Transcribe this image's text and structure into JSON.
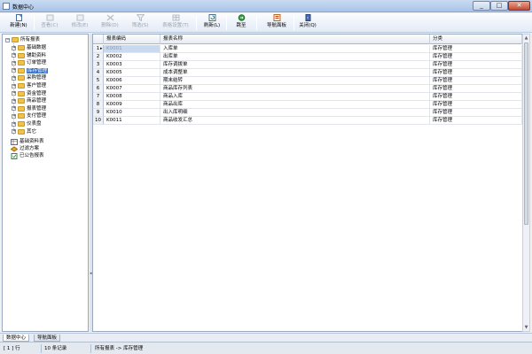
{
  "window": {
    "title": "数据中心"
  },
  "toolbar": {
    "buttons": [
      {
        "label": "新建(N)",
        "icon": "new-file-icon",
        "enabled": true
      },
      {
        "label": "查看(C)",
        "icon": "view-icon",
        "enabled": false
      },
      {
        "label": "修改(E)",
        "icon": "edit-icon",
        "enabled": false
      },
      {
        "label": "删除(D)",
        "icon": "delete-icon",
        "enabled": false
      },
      {
        "label": "筛选(S)",
        "icon": "filter-icon",
        "enabled": false
      },
      {
        "label": "表格设置(T)",
        "icon": "table-settings-icon",
        "enabled": false
      },
      {
        "label": "刷新(L)",
        "icon": "refresh-icon",
        "enabled": true
      },
      {
        "label": "跳至",
        "icon": "goto-icon",
        "enabled": true
      },
      {
        "label": "导航面板",
        "icon": "nav-panel-icon",
        "enabled": true
      },
      {
        "label": "关闭(Q)",
        "icon": "close-door-icon",
        "enabled": true
      }
    ]
  },
  "tree": {
    "root": "所有报表",
    "items": [
      "基础数据",
      "辅助资料",
      "订单管理",
      "库存管理",
      "采购管理",
      "客户管理",
      "资金管理",
      "商品管理",
      "报表管理",
      "支付管理",
      "仪表盘",
      "其它"
    ],
    "selected_index": 3,
    "extras": [
      "基础资料表",
      "过滤方案",
      "已公告报表"
    ]
  },
  "grid": {
    "columns": [
      "报表编码",
      "报表名称",
      "分类"
    ],
    "rows": [
      {
        "no": "1",
        "code": "K0001",
        "name": "入库单",
        "category": "库存管理"
      },
      {
        "no": "2",
        "code": "K0002",
        "name": "出库单",
        "category": "库存管理"
      },
      {
        "no": "3",
        "code": "K0003",
        "name": "库存调拨单",
        "category": "库存管理"
      },
      {
        "no": "4",
        "code": "K0005",
        "name": "成本调整单",
        "category": "库存管理"
      },
      {
        "no": "5",
        "code": "K0006",
        "name": "期末结转",
        "category": "库存管理"
      },
      {
        "no": "6",
        "code": "K0007",
        "name": "商品库存列表",
        "category": "库存管理"
      },
      {
        "no": "7",
        "code": "K0008",
        "name": "商品入库",
        "category": "库存管理"
      },
      {
        "no": "8",
        "code": "K0009",
        "name": "商品出库",
        "category": "库存管理"
      },
      {
        "no": "9",
        "code": "K0010",
        "name": "出入库明细",
        "category": "库存管理"
      },
      {
        "no": "10",
        "code": "K0011",
        "name": "商品收发汇总",
        "category": "库存管理"
      }
    ]
  },
  "tabs": [
    "数据中心",
    "导航面板"
  ],
  "status": {
    "position": "[ 1 ] 行",
    "count": "10 条记录",
    "path": "所有报表 -> 库存管理"
  }
}
